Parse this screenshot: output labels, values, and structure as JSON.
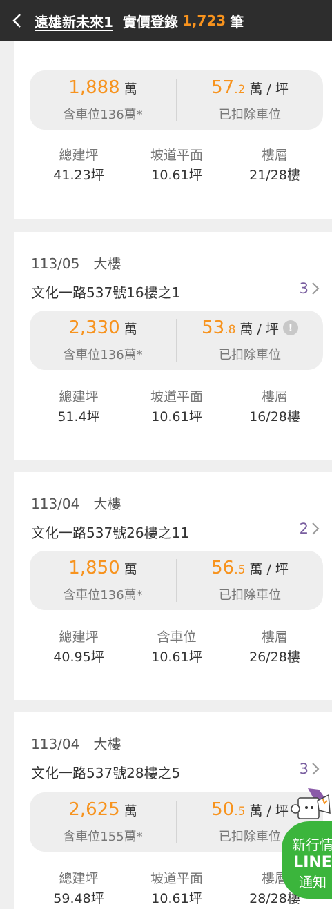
{
  "header": {
    "title": "遠雄新未來1",
    "subtitle": "實價登錄",
    "count": "1,723",
    "count_unit": "筆"
  },
  "cards": [
    {
      "meta": "",
      "type": "",
      "address": "",
      "transactions": "",
      "price_main": "1,888",
      "price_unit": "萬",
      "parking_note": "含車位136萬*",
      "unit_price_int": "57",
      "unit_price_dec": ".2",
      "unit_price_unit": "萬 / 坪",
      "unit_price_note": "已扣除車位",
      "stats": [
        {
          "label": "總建坪",
          "value": "41.23坪"
        },
        {
          "label": "坡道平面",
          "value": "10.61坪"
        },
        {
          "label": "樓層",
          "value": "21/28樓"
        }
      ]
    },
    {
      "meta": "113/05",
      "type": "大樓",
      "address": "文化一路537號16樓之1",
      "transactions": "3",
      "price_main": "2,330",
      "price_unit": "萬",
      "parking_note": "含車位136萬*",
      "unit_price_int": "53",
      "unit_price_dec": ".8",
      "unit_price_unit": "萬 / 坪",
      "unit_price_note": "已扣除車位",
      "stats": [
        {
          "label": "總建坪",
          "value": "51.4坪"
        },
        {
          "label": "坡道平面",
          "value": "10.61坪"
        },
        {
          "label": "樓層",
          "value": "16/28樓"
        }
      ]
    },
    {
      "meta": "113/04",
      "type": "大樓",
      "address": "文化一路537號26樓之11",
      "transactions": "2",
      "price_main": "1,850",
      "price_unit": "萬",
      "parking_note": "含車位136萬*",
      "unit_price_int": "56",
      "unit_price_dec": ".5",
      "unit_price_unit": "萬 / 坪",
      "unit_price_note": "已扣除車位",
      "stats": [
        {
          "label": "總建坪",
          "value": "40.95坪"
        },
        {
          "label": "含車位",
          "value": "10.61坪"
        },
        {
          "label": "樓層",
          "value": "26/28樓"
        }
      ]
    },
    {
      "meta": "113/04",
      "type": "大樓",
      "address": "文化一路537號28樓之5",
      "transactions": "3",
      "price_main": "2,625",
      "price_unit": "萬",
      "parking_note": "含車位155萬*",
      "unit_price_int": "50",
      "unit_price_dec": ".5",
      "unit_price_unit": "萬 / 坪",
      "unit_price_note": "已扣除車位",
      "stats": [
        {
          "label": "總建坪",
          "value": "59.48坪"
        },
        {
          "label": "坡道平面",
          "value": "10.61坪"
        },
        {
          "label": "樓層",
          "value": "28/28樓"
        }
      ]
    }
  ],
  "info_icon_glyph": "!",
  "line_fab": {
    "line1": "新行情",
    "line2": "LINE",
    "line3": "通知"
  },
  "colors": {
    "accent": "#f7931e",
    "header_bg": "#2d2d2d",
    "line_green": "#3bb53c",
    "tx_count": "#7a5fa0"
  }
}
